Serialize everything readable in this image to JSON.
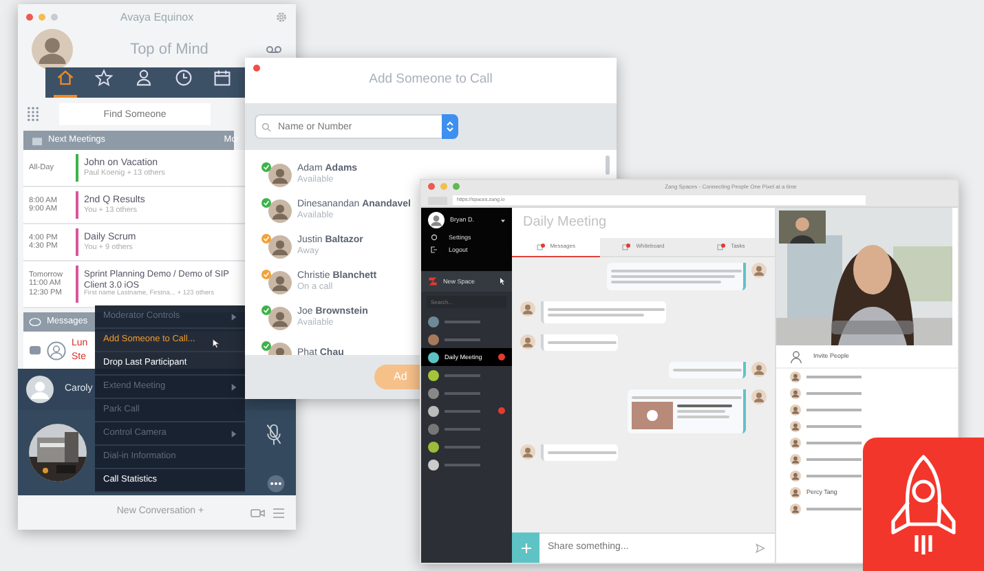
{
  "equinox": {
    "title": "Avaya Equinox",
    "heading": "Top of Mind",
    "nav_tabs": [
      {
        "kind": "home",
        "selected": true
      },
      {
        "kind": "star",
        "selected": false
      },
      {
        "kind": "person",
        "selected": false
      },
      {
        "kind": "clock",
        "selected": false
      },
      {
        "kind": "calendar",
        "selected": false
      }
    ],
    "search": {
      "placeholder": "Find Someone"
    },
    "meetings_header": "Next Meetings",
    "meetings_more": "Mor",
    "meetings": [
      {
        "times": [
          "All-Day"
        ],
        "title": "John on Vacation",
        "attendees": "Paul Koenig + 13 others",
        "color": "#3db24b"
      },
      {
        "times": [
          "8:00 AM",
          "9:00 AM"
        ],
        "title": "2nd Q Results",
        "attendees": "You + 13 others",
        "color": "#d9559b"
      },
      {
        "times": [
          "4:00 PM",
          "4:30 PM"
        ],
        "title": "Daily Scrum",
        "attendees": "You + 9 others",
        "color": "#d9559b"
      },
      {
        "times": [
          "Tomorrow",
          "11:00 AM",
          "12:30 PM"
        ],
        "title": "Sprint Planning Demo / Demo of SIP Client 3.0 iOS",
        "attendees": "First name Lastname, Firstna... + 123 others",
        "color": "#d9559b"
      }
    ],
    "messages_label": "Messages",
    "conversation_lines": [
      "Lun",
      "Ste"
    ],
    "caller": "Caroly",
    "new_conversation": "New Conversation +"
  },
  "context_menu": [
    {
      "label": "Moderator Controls",
      "disabled": true,
      "submenu": true,
      "selected": false
    },
    {
      "label": "Add Someone to Call...",
      "disabled": false,
      "submenu": false,
      "selected": true
    },
    {
      "label": "Drop Last Participant",
      "disabled": false,
      "submenu": false,
      "selected": false
    },
    {
      "label": "Extend Meeting",
      "disabled": true,
      "submenu": true,
      "selected": false
    },
    {
      "label": "Park Call",
      "disabled": true,
      "submenu": false,
      "selected": false
    },
    {
      "label": "Control Camera",
      "disabled": true,
      "submenu": true,
      "selected": false
    },
    {
      "label": "Dial-in Information",
      "disabled": true,
      "submenu": false,
      "selected": false
    },
    {
      "label": "Call Statistics",
      "disabled": false,
      "submenu": false,
      "selected": false
    }
  ],
  "dialog": {
    "title": "Add Someone to Call",
    "search": {
      "placeholder": "Name or Number"
    },
    "contacts": [
      {
        "name": "Adam **Adams**",
        "status": "Available",
        "color": "#3db24b"
      },
      {
        "name": "Dinesanandan **Anandavel**",
        "status": "Available",
        "color": "#3db24b"
      },
      {
        "name": "Justin **Baltazor**",
        "status": "Away",
        "color": "#f0a23a"
      },
      {
        "name": "Christie **Blanchett**",
        "status": "On a call",
        "color": "#f0a23a"
      },
      {
        "name": "Joe **Brownstein**",
        "status": "Available",
        "color": "#3db24b"
      },
      {
        "name": "Phat **Chau**",
        "color": "#3db24b"
      }
    ],
    "button": "Ad"
  },
  "spaces": {
    "title": "Zang Spaces - Connecting People One Pixel at a time",
    "url": "https://spaces.zang.io",
    "user": "Bryan D.",
    "menu": [
      "Settings",
      "Logout"
    ],
    "new_space": "New Space",
    "search": {
      "placeholder": "Search..."
    },
    "list": [
      {
        "selected": false,
        "unread": false
      },
      {
        "selected": false,
        "unread": false
      },
      {
        "label": "Daily Meeting",
        "selected": true,
        "unread": true
      },
      {
        "selected": false,
        "unread": false
      },
      {
        "selected": false,
        "unread": false
      },
      {
        "selected": false,
        "unread": true
      },
      {
        "selected": false,
        "unread": false
      },
      {
        "selected": false,
        "unread": false
      },
      {
        "selected": false,
        "unread": false
      }
    ],
    "heading": "Daily Meeting",
    "tabs": [
      {
        "label": "Messages",
        "selected": true
      },
      {
        "label": "Whiteboard",
        "selected": false
      },
      {
        "label": "Tasks",
        "selected": false
      }
    ],
    "messages": [
      {
        "outgoing": true,
        "kind": "long"
      },
      {
        "outgoing": false,
        "kind": "medium"
      },
      {
        "outgoing": false,
        "kind": "short"
      },
      {
        "outgoing": true,
        "kind": "short"
      },
      {
        "outgoing": true,
        "kind": "link"
      },
      {
        "outgoing": false,
        "kind": "short"
      }
    ],
    "composer": {
      "placeholder": "Share something..."
    },
    "invite": "Invite People",
    "people": [
      {
        "kind": "blurred"
      },
      {
        "kind": "blurred"
      },
      {
        "kind": "blurred"
      },
      {
        "kind": "blurred"
      },
      {
        "kind": "blurred"
      },
      {
        "kind": "blurred"
      },
      {
        "kind": "blurred"
      },
      {
        "kind": "named",
        "name": "Percy Tang"
      },
      {
        "kind": "blurred"
      }
    ]
  }
}
